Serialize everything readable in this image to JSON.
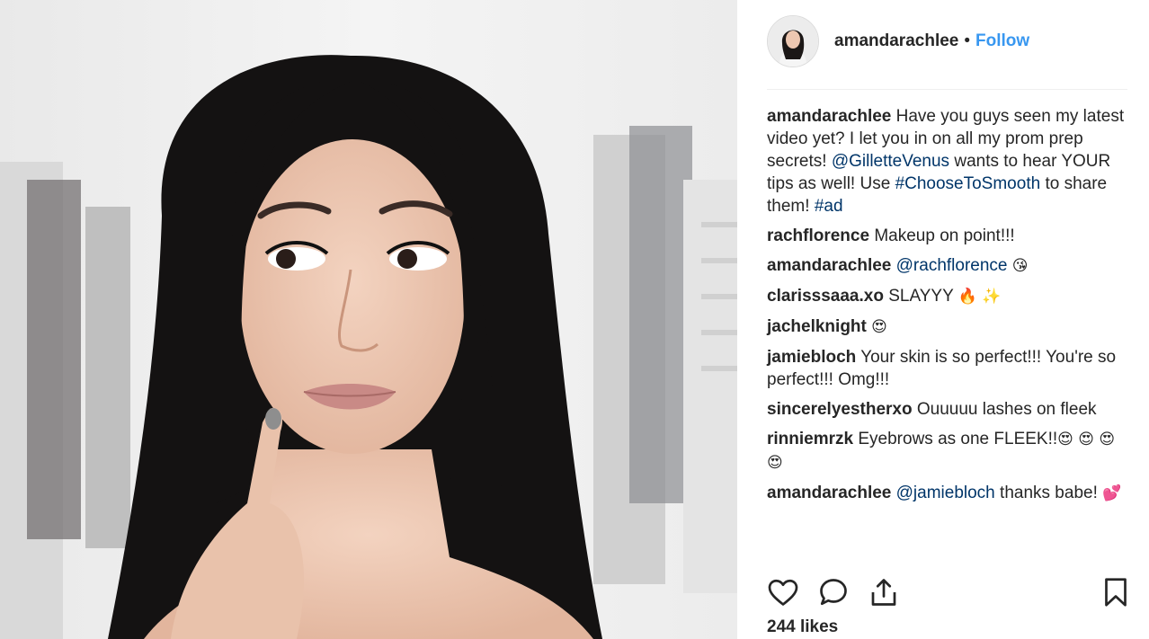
{
  "post": {
    "username": "amandarachlee",
    "separator": "•",
    "follow_label": "Follow",
    "caption": {
      "author": "amandarachlee",
      "text1": "Have you guys seen my latest video yet? I let you in on all my prom prep secrets!",
      "mention": "@GilletteVenus",
      "text2": "wants to hear YOUR tips as well! Use",
      "hashtag1": "#ChooseToSmooth",
      "text3": "to share them!",
      "hashtag2": "#ad"
    },
    "comments": [
      {
        "author": "rachflorence",
        "text": "Makeup on point!!!"
      },
      {
        "author": "amandarachlee",
        "mention": "@rachflorence",
        "emoji": "😘"
      },
      {
        "author": "clarisssaaa.xo",
        "text": "SLAYYY",
        "emoji": "🔥 ✨"
      },
      {
        "author": "jachelknight",
        "emoji": "😍"
      },
      {
        "author": "jamiebloch",
        "text": "Your skin is so perfect!!! You're so perfect!!! Omg!!!"
      },
      {
        "author": "sincerelyestherxo",
        "text": "Ouuuuu lashes on fleek"
      },
      {
        "author": "rinniemrzk",
        "text": "Eyebrows as one FLEEK!!",
        "emoji": "😍 😍 😍 😍"
      },
      {
        "author": "amandarachlee",
        "mention": "@jamiebloch",
        "text": "thanks babe!",
        "emoji": "💕"
      }
    ],
    "actions": {
      "like_icon": "heart-icon",
      "comment_icon": "comment-bubble-icon",
      "share_icon": "share-upload-icon",
      "save_icon": "bookmark-icon"
    },
    "likes": "244 likes"
  }
}
